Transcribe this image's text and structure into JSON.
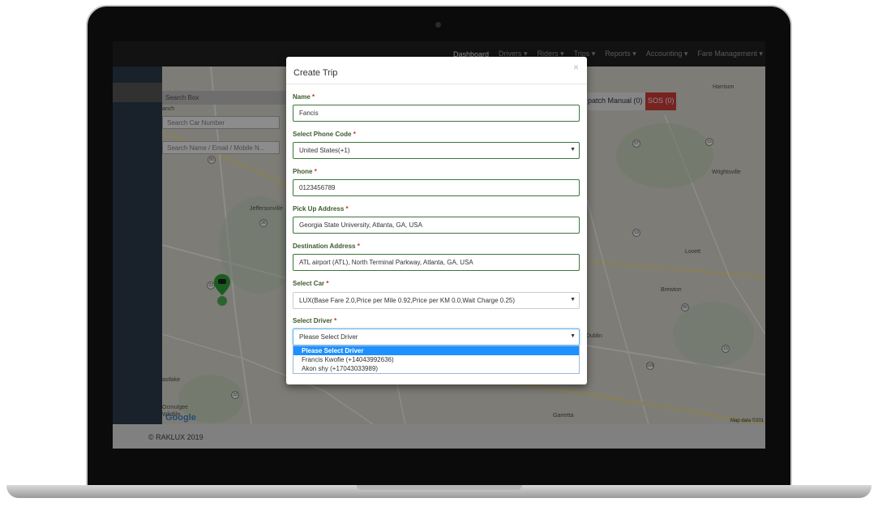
{
  "nav": {
    "items": [
      "Dashboard",
      "Drivers ▾",
      "Riders ▾",
      "Trips ▾",
      "Reports ▾",
      "Accounting ▾",
      "Fare Management ▾"
    ]
  },
  "map": {
    "search_box_label": "Search Box",
    "search_car_placeholder": "Search Car Number",
    "search_name_placeholder": "Search Name / Email / Mobile N...",
    "dispatch_label": "patch Manual (0)",
    "sos_label": "SOS (0)",
    "place_labels": {
      "jeffersonville": "Jeffersonville",
      "lovett": "Lovett",
      "brewton": "Brewton",
      "wrightsville": "Wrightsville",
      "harrison": "Harrison",
      "dublin": "Dublin",
      "garretta": "Garretta",
      "eastlake": "astlake",
      "ocmulgee": "Ocmulgee",
      "anch": "anch",
      "wildlife": "Wildlife"
    },
    "google_text": "Google",
    "map_data_text": "Map data ©201"
  },
  "footer": {
    "text": "© RAKLUX 2019"
  },
  "modal": {
    "title": "Create Trip",
    "close_symbol": "×",
    "name_label": "Name",
    "name_value": "Fancis",
    "phone_code_label": "Select Phone Code",
    "phone_code_value": "United States(+1)",
    "phone_label": "Phone",
    "phone_value": "0123456789",
    "pickup_label": "Pick Up Address",
    "pickup_value": "Georgia State University, Atlanta, GA, USA",
    "destination_label": "Destination Address",
    "destination_value": "ATL airport (ATL), North Terminal Parkway, Atlanta, GA, USA",
    "car_label": "Select Car",
    "car_value": "LUX(Base Fare 2.0,Price per Mile 0.92,Price per KM 0.0,Wait Charge 0.25)",
    "driver_label": "Select Driver",
    "driver_value": "Please Select Driver",
    "required_mark": "*",
    "arrow": "▼",
    "driver_options": [
      "Please Select Driver",
      "Francis Kwofie (+14043992636)",
      "Akon shy (+17043033989)"
    ]
  },
  "colors": {
    "label_green": "#3c5a2e",
    "sos_red": "#d9413c",
    "selected_blue": "#1e90ff"
  }
}
